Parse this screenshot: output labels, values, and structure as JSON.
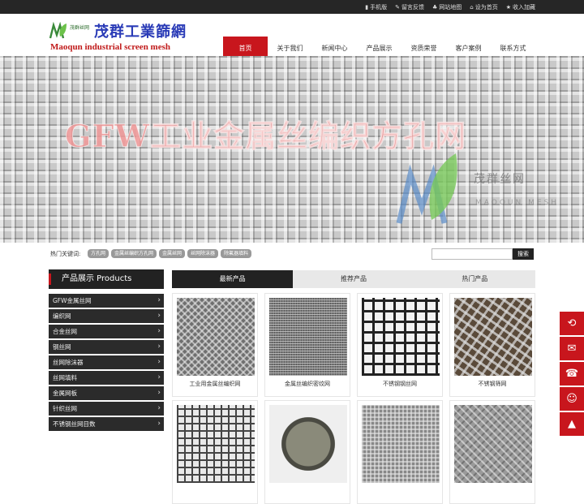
{
  "topbar": {
    "links": [
      {
        "icon": "mobile-icon",
        "glyph": "▮",
        "label": "手机版"
      },
      {
        "icon": "message-icon",
        "glyph": "✎",
        "label": "留言反馈"
      },
      {
        "icon": "sitemap-icon",
        "glyph": "♣",
        "label": "网站地图"
      },
      {
        "icon": "home-icon",
        "glyph": "⌂",
        "label": "设为首页"
      },
      {
        "icon": "star-icon",
        "glyph": "★",
        "label": "收入加藏"
      }
    ]
  },
  "logo": {
    "small_cn": "茂群丝网",
    "cn": "茂群工業篩網",
    "en": "Maoqun industrial screen mesh"
  },
  "nav": {
    "items": [
      "首页",
      "关于我们",
      "新闻中心",
      "产品展示",
      "资质荣誉",
      "客户案例",
      "联系方式"
    ]
  },
  "banner": {
    "title": "GFW工业金属丝编织方孔网",
    "watermark_cn": "茂群丝网",
    "watermark_en": "MAOQUN MESH"
  },
  "hot": {
    "label": "热门关键词:",
    "tags": [
      "方孔网",
      "金属丝编织方孔网",
      "金属丝网",
      "丝网除沫器",
      "除氟器填料"
    ],
    "search_button": "搜索"
  },
  "sidebar": {
    "title": "产品展示 Products",
    "items": [
      "GFW金属丝网",
      "编织网",
      "合金丝网",
      "钢丝网",
      "丝网除沫器",
      "丝网填料",
      "金属网板",
      "针织丝网",
      "不锈钢丝网目数"
    ]
  },
  "tabs": [
    "最新产品",
    "推荐产品",
    "热门产品"
  ],
  "products": [
    {
      "name": "工业用金属丝编织网"
    },
    {
      "name": "金属丝编织密纹网"
    },
    {
      "name": "不锈钢钢丝网"
    },
    {
      "name": "不锈钢筛网"
    },
    {
      "name": ""
    },
    {
      "name": ""
    },
    {
      "name": ""
    },
    {
      "name": ""
    }
  ],
  "float_buttons": [
    {
      "icon": "back-icon",
      "glyph": "⟲"
    },
    {
      "icon": "wechat-icon",
      "glyph": "✉"
    },
    {
      "icon": "phone-icon",
      "glyph": "☎"
    },
    {
      "icon": "qq-icon",
      "glyph": "☺"
    },
    {
      "icon": "top-icon",
      "glyph": "▲"
    }
  ],
  "colors": {
    "accent": "#c8161d",
    "dark": "#222222"
  }
}
